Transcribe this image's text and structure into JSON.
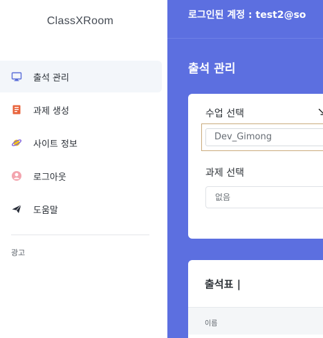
{
  "sidebar": {
    "brand": "ClassXRoom",
    "items": [
      {
        "label": "출석 관리",
        "icon": "monitor-icon",
        "active": true
      },
      {
        "label": "과제 생성",
        "icon": "book-icon",
        "active": false
      },
      {
        "label": "사이트 정보",
        "icon": "planet-icon",
        "active": false
      },
      {
        "label": "로그아웃",
        "icon": "user-icon",
        "active": false
      },
      {
        "label": "도움말",
        "icon": "paper-plane-icon",
        "active": false
      }
    ],
    "ad_label": "광고"
  },
  "header": {
    "login_text": "로그인된 계정 : test2@so"
  },
  "main": {
    "page_title": "출석 관리",
    "class_select": {
      "label": "수업 선택",
      "value": "Dev_Gimong"
    },
    "assignment_select": {
      "label": "과제 선택",
      "value": "없음"
    },
    "attendance": {
      "title": "출석표 |",
      "column_name": "이름"
    }
  },
  "colors": {
    "primary": "#5c6fe0",
    "sidebar_active": "#f3f6fa"
  }
}
